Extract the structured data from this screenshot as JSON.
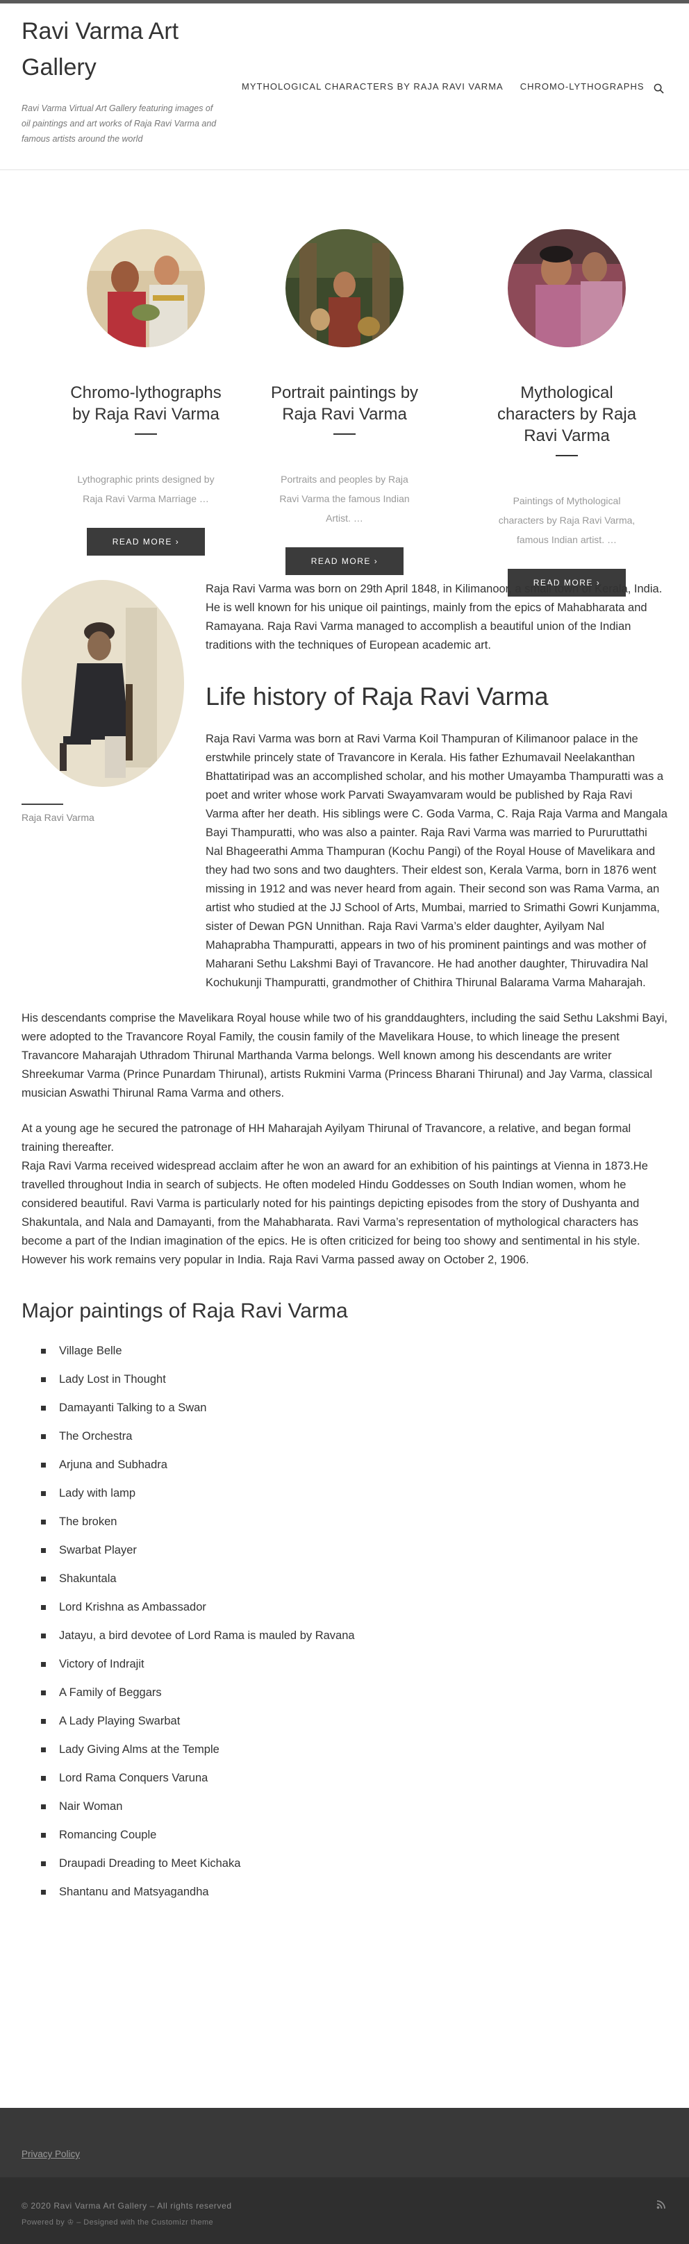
{
  "site": {
    "title": "Ravi Varma Art Gallery",
    "tagline": "Ravi Varma Virtual Art Gallery featuring images of oil paintings and art works of Raja Ravi Varma and famous artists around the world"
  },
  "nav": {
    "items": [
      "MYTHOLOGICAL CHARACTERS BY RAJA RAVI VARMA",
      "CHROMO-LYTHOGRAPHS"
    ],
    "search_icon": "search-icon"
  },
  "featured": [
    {
      "title": "Chromo-lythographs by Raja Ravi Varma",
      "excerpt": "Lythographic prints designed by Raja Ravi Varma Marriage …",
      "button": "READ MORE ›"
    },
    {
      "title": "Portrait paintings by Raja Ravi Varma",
      "excerpt": "Portraits and peoples by Raja Ravi Varma the famous Indian Artist. …",
      "button": "READ MORE ›"
    },
    {
      "title": "Mythological characters by Raja Ravi Varma",
      "excerpt": "Paintings of Mythological characters by Raja Ravi Varma, famous Indian artist. …",
      "button": "READ MORE ›"
    }
  ],
  "article": {
    "portrait_caption": "Raja Ravi Varma",
    "intro": "Raja Ravi Varma was born on 29th April 1848, in Kilimanoor, a small town of Kerala, India. He is well known for his unique oil paintings, mainly from the epics of Mahabharata and Ramayana. Raja Ravi Varma managed to accomplish a beautiful union of the Indian traditions with the techniques of European academic art.",
    "life_title": "Life history of Raja Ravi Varma",
    "paragraphs": [
      "Raja Ravi Varma was born at Ravi Varma Koil Thampuran of Kilimanoor palace in the erstwhile princely state of Travancore in Kerala. His father Ezhumavail Neelakanthan Bhattatiripad was an accomplished scholar, and his mother Umayamba Thampuratti was a poet and writer whose work Parvati Swayamvaram would be published by Raja Ravi Varma after her death. His siblings were C. Goda Varma, C. Raja Raja Varma and Mangala Bayi Thampuratti, who was also a painter. Raja Ravi Varma was married to Pururuttathi Nal Bhageerathi Amma Thampuran (Kochu Pangi) of the Royal House of Mavelikara and they had two sons and two daughters. Their eldest son, Kerala Varma, born in 1876 went missing in 1912 and was never heard from again. Their second son was Rama Varma, an artist who studied at the JJ School of Arts, Mumbai, married to Srimathi Gowri Kunjamma, sister of Dewan PGN Unnithan. Raja Ravi Varma’s elder daughter, Ayilyam Nal Mahaprabha Thampuratti, appears in two of his prominent paintings and was mother of Maharani Sethu Lakshmi Bayi of Travancore. He had another daughter, Thiruvadira Nal Kochukunji Thampuratti, grandmother of Chithira Thirunal Balarama Varma Maharajah.",
      "His descendants comprise the Mavelikara Royal house while two of his granddaughters, including the said Sethu Lakshmi Bayi, were adopted to the Travancore Royal Family, the cousin family of the Mavelikara House, to which lineage the present Travancore Maharajah Uthradom Thirunal Marthanda Varma belongs. Well known among his descendants are writer Shreekumar Varma (Prince Punardam Thirunal), artists Rukmini Varma (Princess Bharani Thirunal) and Jay Varma, classical musician Aswathi Thirunal Rama Varma and others.",
      "At a young age he secured the patronage of HH Maharajah Ayilyam Thirunal of Travancore, a relative, and began formal training thereafter.",
      "Raja Ravi Varma received widespread acclaim after he won an award for an exhibition of his paintings at Vienna in 1873.He travelled throughout India in search of subjects. He often modeled Hindu Goddesses on South Indian women, whom he considered beautiful. Ravi Varma is particularly noted for his paintings depicting episodes from the story of Dushyanta and Shakuntala, and Nala and Damayanti, from the Mahabharata. Ravi Varma’s representation of mythological characters has become a part of the Indian imagination of the epics. He is often criticized for being too showy and sentimental in his style. However his work remains very popular in India. Raja Ravi Varma passed away on October 2, 1906."
    ],
    "major_title": "Major paintings of Raja Ravi Varma",
    "paintings": [
      "Village Belle",
      "Lady Lost in Thought",
      "Damayanti Talking to a Swan",
      "The Orchestra",
      "Arjuna and Subhadra",
      "Lady with lamp",
      "The broken",
      "Swarbat Player",
      "Shakuntala",
      "Lord Krishna as Ambassador",
      "Jatayu, a bird devotee of Lord Rama is mauled by Ravana",
      "Victory of Indrajit",
      "A Family of Beggars",
      "A Lady Playing Swarbat",
      "Lady Giving Alms at the Temple",
      "Lord Rama Conquers Varuna",
      "Nair Woman",
      "Romancing Couple",
      "Draupadi Dreading to Meet Kichaka",
      "Shantanu and Matsyagandha"
    ]
  },
  "footer": {
    "privacy": "Privacy Policy",
    "copyright": "© 2020 Ravi Varma Art Gallery – All rights reserved",
    "powered": "Powered by ♔ – Designed with the Customizr theme",
    "rss_icon": "rss-icon"
  },
  "colors": {
    "button_bg": "#3b3b3b",
    "footer_bg": "#393939",
    "colophon_bg": "#2f2f2f",
    "text": "#333333"
  }
}
